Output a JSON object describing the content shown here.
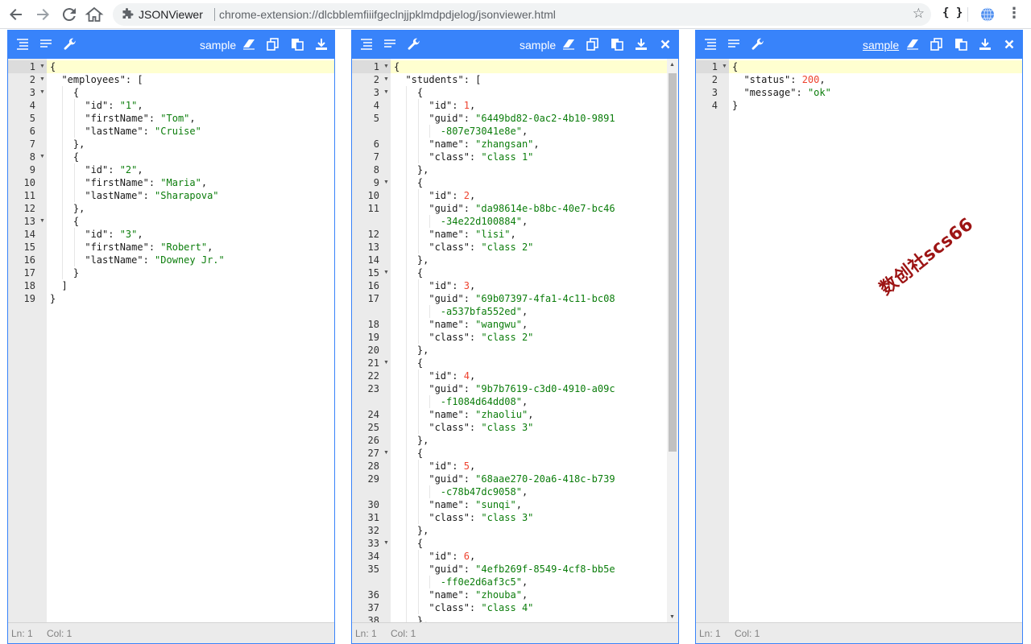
{
  "browser": {
    "tab_title": "JSONViewer",
    "url": "chrome-extension://dlcbblemfiiifgeclnjjpklmdpdjelog/jsonviewer.html",
    "ext_braces": "{ }"
  },
  "colors": {
    "accent": "#3883fa",
    "key": "#1a1a1a",
    "string": "#0b7d0b",
    "number": "#ee422e",
    "gutter": "#ebebeb",
    "active_line": "#ffffd0"
  },
  "icons": [
    "back-arrow-icon",
    "forward-arrow-icon",
    "reload-icon",
    "home-icon",
    "extension-puzzle-icon",
    "star-icon",
    "globe-icon",
    "menu-dots-icon",
    "format-icon",
    "compact-icon",
    "repair-icon",
    "clear-icon",
    "copy-icon",
    "paste-icon",
    "download-icon",
    "close-icon"
  ],
  "panels": [
    {
      "title": "sample",
      "status": {
        "ln": "Ln: 1",
        "col": "Col: 1"
      },
      "lines": [
        {
          "n": "1",
          "fold": true,
          "t": [
            [
              "p",
              "{"
            ]
          ]
        },
        {
          "n": "2",
          "fold": true,
          "t": [
            [
              "k",
              "  \"employees\""
            ],
            [
              "p",
              ": ["
            ]
          ]
        },
        {
          "n": "3",
          "fold": true,
          "t": [
            [
              "p",
              "    {"
            ]
          ]
        },
        {
          "n": "4",
          "t": [
            [
              "k",
              "      \"id\""
            ],
            [
              "p",
              ": "
            ],
            [
              "s",
              "\"1\""
            ],
            [
              "p",
              ","
            ]
          ]
        },
        {
          "n": "5",
          "t": [
            [
              "k",
              "      \"firstName\""
            ],
            [
              "p",
              ": "
            ],
            [
              "s",
              "\"Tom\""
            ],
            [
              "p",
              ","
            ]
          ]
        },
        {
          "n": "6",
          "t": [
            [
              "k",
              "      \"lastName\""
            ],
            [
              "p",
              ": "
            ],
            [
              "s",
              "\"Cruise\""
            ]
          ]
        },
        {
          "n": "7",
          "t": [
            [
              "p",
              "    },"
            ]
          ]
        },
        {
          "n": "8",
          "fold": true,
          "t": [
            [
              "p",
              "    {"
            ]
          ]
        },
        {
          "n": "9",
          "t": [
            [
              "k",
              "      \"id\""
            ],
            [
              "p",
              ": "
            ],
            [
              "s",
              "\"2\""
            ],
            [
              "p",
              ","
            ]
          ]
        },
        {
          "n": "10",
          "t": [
            [
              "k",
              "      \"firstName\""
            ],
            [
              "p",
              ": "
            ],
            [
              "s",
              "\"Maria\""
            ],
            [
              "p",
              ","
            ]
          ]
        },
        {
          "n": "11",
          "t": [
            [
              "k",
              "      \"lastName\""
            ],
            [
              "p",
              ": "
            ],
            [
              "s",
              "\"Sharapova\""
            ]
          ]
        },
        {
          "n": "12",
          "t": [
            [
              "p",
              "    },"
            ]
          ]
        },
        {
          "n": "13",
          "fold": true,
          "t": [
            [
              "p",
              "    {"
            ]
          ]
        },
        {
          "n": "14",
          "t": [
            [
              "k",
              "      \"id\""
            ],
            [
              "p",
              ": "
            ],
            [
              "s",
              "\"3\""
            ],
            [
              "p",
              ","
            ]
          ]
        },
        {
          "n": "15",
          "t": [
            [
              "k",
              "      \"firstName\""
            ],
            [
              "p",
              ": "
            ],
            [
              "s",
              "\"Robert\""
            ],
            [
              "p",
              ","
            ]
          ]
        },
        {
          "n": "16",
          "t": [
            [
              "k",
              "      \"lastName\""
            ],
            [
              "p",
              ": "
            ],
            [
              "s",
              "\"Downey Jr.\""
            ]
          ]
        },
        {
          "n": "17",
          "t": [
            [
              "p",
              "    }"
            ]
          ]
        },
        {
          "n": "18",
          "t": [
            [
              "p",
              "  ]"
            ]
          ]
        },
        {
          "n": "19",
          "t": [
            [
              "p",
              "}"
            ]
          ]
        }
      ]
    },
    {
      "title": "sample",
      "status": {
        "ln": "Ln: 1",
        "col": "Col: 1"
      },
      "lines": [
        {
          "n": "1",
          "fold": true,
          "t": [
            [
              "p",
              "{"
            ]
          ]
        },
        {
          "n": "2",
          "fold": true,
          "t": [
            [
              "k",
              "  \"students\""
            ],
            [
              "p",
              ": ["
            ]
          ]
        },
        {
          "n": "3",
          "fold": true,
          "t": [
            [
              "p",
              "    {"
            ]
          ]
        },
        {
          "n": "4",
          "t": [
            [
              "k",
              "      \"id\""
            ],
            [
              "p",
              ": "
            ],
            [
              "n",
              "1"
            ],
            [
              "p",
              ","
            ]
          ]
        },
        {
          "n": "5",
          "t": [
            [
              "k",
              "      \"guid\""
            ],
            [
              "p",
              ": "
            ],
            [
              "s",
              "\"6449bd82-0ac2-4b10-9891"
            ]
          ]
        },
        {
          "n": "",
          "t": [
            [
              "s",
              "        -807e73041e8e\""
            ],
            [
              "p",
              ","
            ]
          ]
        },
        {
          "n": "6",
          "t": [
            [
              "k",
              "      \"name\""
            ],
            [
              "p",
              ": "
            ],
            [
              "s",
              "\"zhangsan\""
            ],
            [
              "p",
              ","
            ]
          ]
        },
        {
          "n": "7",
          "t": [
            [
              "k",
              "      \"class\""
            ],
            [
              "p",
              ": "
            ],
            [
              "s",
              "\"class 1\""
            ]
          ]
        },
        {
          "n": "8",
          "t": [
            [
              "p",
              "    },"
            ]
          ]
        },
        {
          "n": "9",
          "fold": true,
          "t": [
            [
              "p",
              "    {"
            ]
          ]
        },
        {
          "n": "10",
          "t": [
            [
              "k",
              "      \"id\""
            ],
            [
              "p",
              ": "
            ],
            [
              "n",
              "2"
            ],
            [
              "p",
              ","
            ]
          ]
        },
        {
          "n": "11",
          "t": [
            [
              "k",
              "      \"guid\""
            ],
            [
              "p",
              ": "
            ],
            [
              "s",
              "\"da98614e-b8bc-40e7-bc46"
            ]
          ]
        },
        {
          "n": "",
          "t": [
            [
              "s",
              "        -34e22d100884\""
            ],
            [
              "p",
              ","
            ]
          ]
        },
        {
          "n": "12",
          "t": [
            [
              "k",
              "      \"name\""
            ],
            [
              "p",
              ": "
            ],
            [
              "s",
              "\"lisi\""
            ],
            [
              "p",
              ","
            ]
          ]
        },
        {
          "n": "13",
          "t": [
            [
              "k",
              "      \"class\""
            ],
            [
              "p",
              ": "
            ],
            [
              "s",
              "\"class 2\""
            ]
          ]
        },
        {
          "n": "14",
          "t": [
            [
              "p",
              "    },"
            ]
          ]
        },
        {
          "n": "15",
          "fold": true,
          "t": [
            [
              "p",
              "    {"
            ]
          ]
        },
        {
          "n": "16",
          "t": [
            [
              "k",
              "      \"id\""
            ],
            [
              "p",
              ": "
            ],
            [
              "n",
              "3"
            ],
            [
              "p",
              ","
            ]
          ]
        },
        {
          "n": "17",
          "t": [
            [
              "k",
              "      \"guid\""
            ],
            [
              "p",
              ": "
            ],
            [
              "s",
              "\"69b07397-4fa1-4c11-bc08"
            ]
          ]
        },
        {
          "n": "",
          "t": [
            [
              "s",
              "        -a537bfa552ed\""
            ],
            [
              "p",
              ","
            ]
          ]
        },
        {
          "n": "18",
          "t": [
            [
              "k",
              "      \"name\""
            ],
            [
              "p",
              ": "
            ],
            [
              "s",
              "\"wangwu\""
            ],
            [
              "p",
              ","
            ]
          ]
        },
        {
          "n": "19",
          "t": [
            [
              "k",
              "      \"class\""
            ],
            [
              "p",
              ": "
            ],
            [
              "s",
              "\"class 2\""
            ]
          ]
        },
        {
          "n": "20",
          "t": [
            [
              "p",
              "    },"
            ]
          ]
        },
        {
          "n": "21",
          "fold": true,
          "t": [
            [
              "p",
              "    {"
            ]
          ]
        },
        {
          "n": "22",
          "t": [
            [
              "k",
              "      \"id\""
            ],
            [
              "p",
              ": "
            ],
            [
              "n",
              "4"
            ],
            [
              "p",
              ","
            ]
          ]
        },
        {
          "n": "23",
          "t": [
            [
              "k",
              "      \"guid\""
            ],
            [
              "p",
              ": "
            ],
            [
              "s",
              "\"9b7b7619-c3d0-4910-a09c"
            ]
          ]
        },
        {
          "n": "",
          "t": [
            [
              "s",
              "        -f1084d64dd08\""
            ],
            [
              "p",
              ","
            ]
          ]
        },
        {
          "n": "24",
          "t": [
            [
              "k",
              "      \"name\""
            ],
            [
              "p",
              ": "
            ],
            [
              "s",
              "\"zhaoliu\""
            ],
            [
              "p",
              ","
            ]
          ]
        },
        {
          "n": "25",
          "t": [
            [
              "k",
              "      \"class\""
            ],
            [
              "p",
              ": "
            ],
            [
              "s",
              "\"class 3\""
            ]
          ]
        },
        {
          "n": "26",
          "t": [
            [
              "p",
              "    },"
            ]
          ]
        },
        {
          "n": "27",
          "fold": true,
          "t": [
            [
              "p",
              "    {"
            ]
          ]
        },
        {
          "n": "28",
          "t": [
            [
              "k",
              "      \"id\""
            ],
            [
              "p",
              ": "
            ],
            [
              "n",
              "5"
            ],
            [
              "p",
              ","
            ]
          ]
        },
        {
          "n": "29",
          "t": [
            [
              "k",
              "      \"guid\""
            ],
            [
              "p",
              ": "
            ],
            [
              "s",
              "\"68aae270-20a6-418c-b739"
            ]
          ]
        },
        {
          "n": "",
          "t": [
            [
              "s",
              "        -c78b47dc9058\""
            ],
            [
              "p",
              ","
            ]
          ]
        },
        {
          "n": "30",
          "t": [
            [
              "k",
              "      \"name\""
            ],
            [
              "p",
              ": "
            ],
            [
              "s",
              "\"sunqi\""
            ],
            [
              "p",
              ","
            ]
          ]
        },
        {
          "n": "31",
          "t": [
            [
              "k",
              "      \"class\""
            ],
            [
              "p",
              ": "
            ],
            [
              "s",
              "\"class 3\""
            ]
          ]
        },
        {
          "n": "32",
          "t": [
            [
              "p",
              "    },"
            ]
          ]
        },
        {
          "n": "33",
          "fold": true,
          "t": [
            [
              "p",
              "    {"
            ]
          ]
        },
        {
          "n": "34",
          "t": [
            [
              "k",
              "      \"id\""
            ],
            [
              "p",
              ": "
            ],
            [
              "n",
              "6"
            ],
            [
              "p",
              ","
            ]
          ]
        },
        {
          "n": "35",
          "t": [
            [
              "k",
              "      \"guid\""
            ],
            [
              "p",
              ": "
            ],
            [
              "s",
              "\"4efb269f-8549-4cf8-bb5e"
            ]
          ]
        },
        {
          "n": "",
          "t": [
            [
              "s",
              "        -ff0e2d6af3c5\""
            ],
            [
              "p",
              ","
            ]
          ]
        },
        {
          "n": "36",
          "t": [
            [
              "k",
              "      \"name\""
            ],
            [
              "p",
              ": "
            ],
            [
              "s",
              "\"zhouba\""
            ],
            [
              "p",
              ","
            ]
          ]
        },
        {
          "n": "37",
          "t": [
            [
              "k",
              "      \"class\""
            ],
            [
              "p",
              ": "
            ],
            [
              "s",
              "\"class 4\""
            ]
          ]
        },
        {
          "n": "38",
          "t": [
            [
              "p",
              "    },"
            ]
          ]
        }
      ]
    },
    {
      "title": "sample",
      "status": {
        "ln": "Ln: 1",
        "col": "Col: 1"
      },
      "lines": [
        {
          "n": "1",
          "fold": true,
          "t": [
            [
              "p",
              "{"
            ]
          ]
        },
        {
          "n": "2",
          "t": [
            [
              "k",
              "  \"status\""
            ],
            [
              "p",
              ": "
            ],
            [
              "n",
              "200"
            ],
            [
              "p",
              ","
            ]
          ]
        },
        {
          "n": "3",
          "t": [
            [
              "k",
              "  \"message\""
            ],
            [
              "p",
              ": "
            ],
            [
              "s",
              "\"ok\""
            ]
          ]
        },
        {
          "n": "4",
          "t": [
            [
              "p",
              "}"
            ]
          ]
        }
      ]
    }
  ],
  "watermark": "数创社scs66"
}
